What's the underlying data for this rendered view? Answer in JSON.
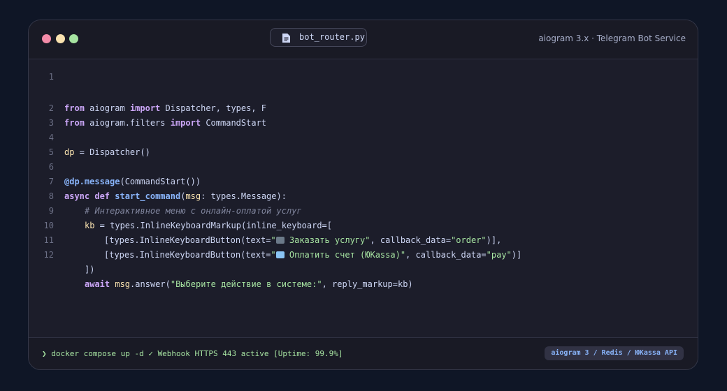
{
  "window": {
    "tab_filename": "bot_router.py",
    "subtitle": "aiogram 3.x · Telegram Bot Service"
  },
  "code": {
    "line_numbers": [
      "1",
      "2",
      "3",
      "4",
      "5",
      "6",
      "7",
      "8",
      "9",
      "10",
      "11",
      "12"
    ],
    "l2_kw1": "from",
    "l2_mod": " aiogram ",
    "l2_kw2": "import",
    "l2_rest": " Dispatcher, types, F",
    "l3_kw1": "from",
    "l3_mod": " aiogram.filters ",
    "l3_kw2": "import",
    "l3_rest": " CommandStart",
    "l5_var": "dp",
    "l5_rest": " = Dispatcher()",
    "l7_deco": "@dp.message",
    "l7_rest": "(CommandStart())",
    "l8_kw1": "async",
    "l8_kw2": "def",
    "l8_fn": "start_command",
    "l8_open": "(",
    "l8_param": "msg",
    "l8_rest": ": types.Message):",
    "l9_comment": "# Интерактивное меню с онлайн-оплатой услуг",
    "l10_var": "kb",
    "l10_rest": " = types.InlineKeyboardMarkup(inline_keyboard=[",
    "l11_pre": "[types.InlineKeyboardButton(text=",
    "l11_str1a": "\"",
    "l11_str1b": " Заказать услугу\"",
    "l11_mid": ", callback_data=",
    "l11_str2": "\"order\"",
    "l11_end": ")],",
    "l12_pre": "[types.InlineKeyboardButton(text=",
    "l12_str1a": "\"",
    "l12_str1b": " Оплатить счет (ЮKassa)\"",
    "l12_mid": ", callback_data=",
    "l12_str2": "\"pay\"",
    "l12_end": ")]",
    "l13_text": "])",
    "l14_kw": "await",
    "l14_var": "msg",
    "l14_mid": ".answer(",
    "l14_str": "\"Выберите действие в системе:\"",
    "l14_end": ", reply_markup=kb)"
  },
  "status": {
    "terminal_text": "❯ docker compose up -d ✓ Webhook HTTPS 443 active [Uptime: 99.9%]",
    "stack_badge": "aiogram 3 / Redis / ЮKassa API"
  },
  "colors": {
    "background": "#0f1626",
    "window": "#1c1d2a",
    "keyword": "#cba6f7",
    "function": "#89b4fa",
    "string": "#a6e3a1",
    "comment": "#7f849c",
    "variable": "#f9e2af"
  },
  "icons": {
    "window_controls": [
      "close-dot",
      "minimize-dot",
      "maximize-dot"
    ],
    "tab": "file-icon",
    "emoji_order": "shopping-cart-icon",
    "emoji_pay": "credit-card-icon"
  }
}
